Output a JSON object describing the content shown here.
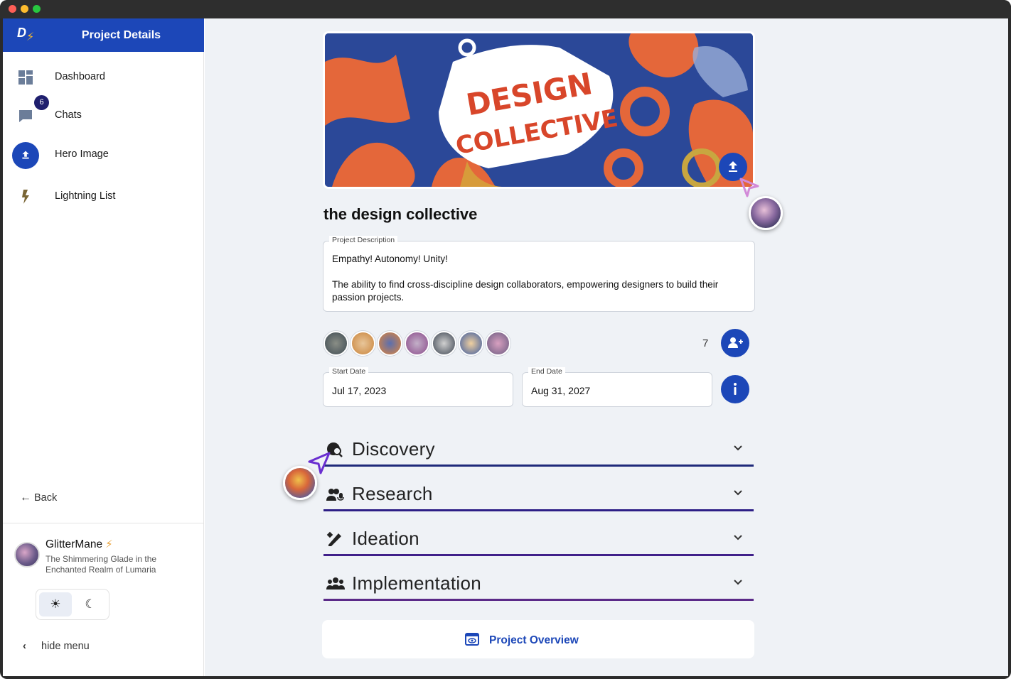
{
  "sidebar": {
    "logo_text": "D",
    "header_title": "Project Details",
    "items": [
      {
        "label": "Dashboard",
        "icon": "dashboard-icon"
      },
      {
        "label": "Chats",
        "icon": "chat-icon",
        "badge": "6"
      },
      {
        "label": "Hero Image",
        "icon": "upload-icon"
      },
      {
        "label": "Lightning List",
        "icon": "lightning-icon"
      }
    ],
    "back_label": "Back",
    "user": {
      "name": "GlitterMane",
      "location": "The Shimmering Glade in the Enchanted Realm of Lumaria"
    },
    "theme": {
      "light_icon": "☀",
      "dark_icon": "☾",
      "selected": "light"
    },
    "hide_menu_label": "hide menu"
  },
  "project": {
    "hero_line1": "DESIGN",
    "hero_line2": "COLLECTIVE",
    "title": "the design collective",
    "description_label": "Project Description",
    "description": "Empathy! Autonomy! Unity!\n\nThe ability to find cross-discipline design collaborators, empowering designers to build their passion projects.",
    "member_count": "7",
    "start_date_label": "Start Date",
    "start_date": "Jul 17, 2023",
    "end_date_label": "End Date",
    "end_date": "Aug 31, 2027"
  },
  "phases": [
    {
      "label": "Discovery",
      "icon": "globe-search-icon",
      "color": "#1f2a7a"
    },
    {
      "label": "Research",
      "icon": "users-mic-icon",
      "color": "#2d1f86"
    },
    {
      "label": "Ideation",
      "icon": "pen-ruler-icon",
      "color": "#40208a"
    },
    {
      "label": "Implementation",
      "icon": "people-group-icon",
      "color": "#5b2a88"
    }
  ],
  "overview_label": "Project Overview",
  "colors": {
    "accent": "#1c47b8",
    "background": "#eff2f6",
    "hero_orange": "#e4673a",
    "hero_navy": "#2b4898"
  }
}
